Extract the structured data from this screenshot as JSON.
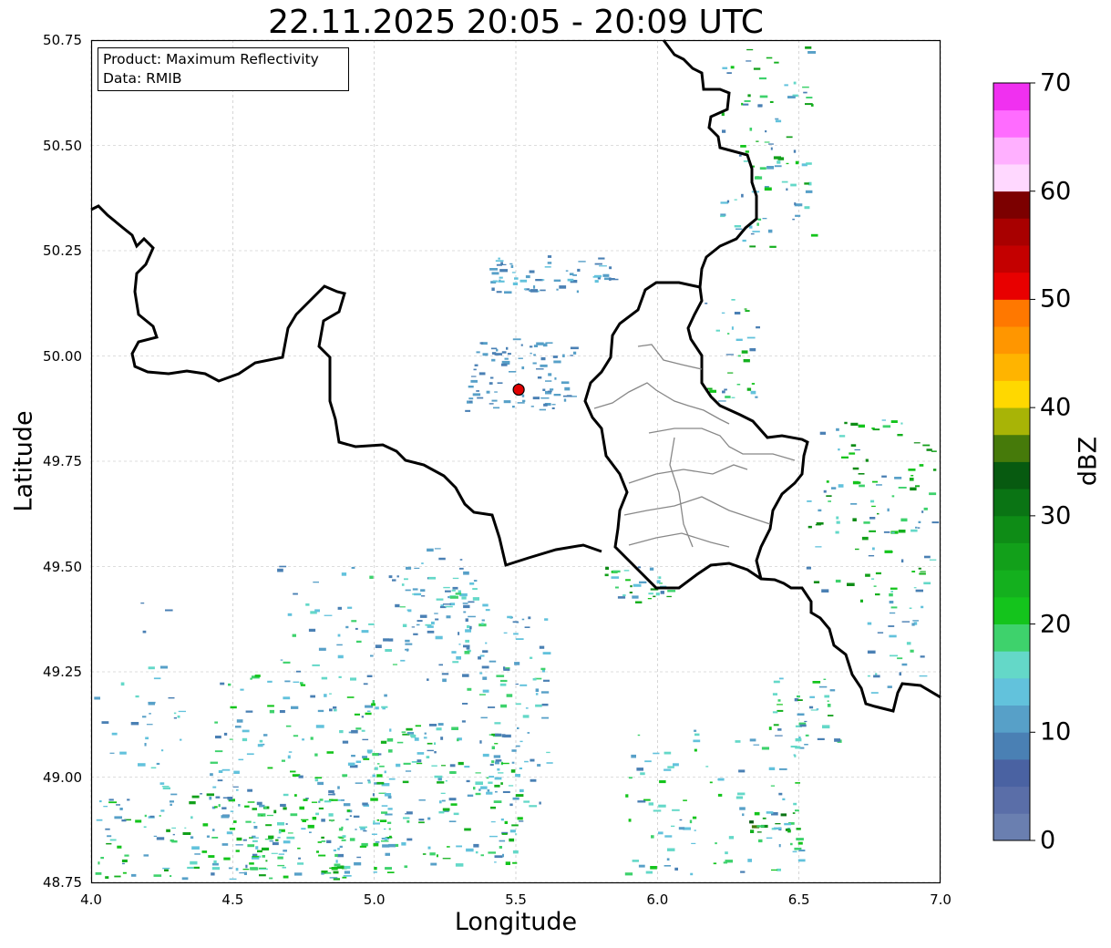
{
  "title": "22.11.2025 20:05 - 20:09 UTC",
  "xlabel": "Longitude",
  "ylabel": "Latitude",
  "colorbar_label": "dBZ",
  "info": {
    "product": "Product: Maximum Reflectivity",
    "data": "Data: RMIB"
  },
  "x_ticks": [
    "4.0",
    "4.5",
    "5.0",
    "5.5",
    "6.0",
    "6.5",
    "7.0"
  ],
  "y_ticks": [
    "48.75",
    "49.00",
    "49.25",
    "49.50",
    "49.75",
    "50.00",
    "50.25",
    "50.50",
    "50.75"
  ],
  "colorbar_ticks": [
    "0",
    "10",
    "20",
    "30",
    "40",
    "50",
    "60",
    "70"
  ],
  "colors": {
    "border": "#000000",
    "admin_border": "#888888",
    "radar_marker": "#e00000",
    "colorbar": [
      "#6a7fb0",
      "#5a6ea8",
      "#4a62a2",
      "#4a80b4",
      "#57a0c8",
      "#62c2dc",
      "#64d8c8",
      "#3ed26c",
      "#14c41c",
      "#14b01e",
      "#12a01a",
      "#0e8c16",
      "#0a7414",
      "#075a10",
      "#467a0a",
      "#a8b406",
      "#ffd800",
      "#ffb400",
      "#ff9600",
      "#ff7800",
      "#e80000",
      "#c40000",
      "#a80000",
      "#7c0000",
      "#ffd8ff",
      "#ffb0ff",
      "#ff6cff",
      "#f030f0"
    ]
  },
  "map": {
    "lon_range": [
      4.0,
      7.0
    ],
    "lat_range": [
      48.75,
      50.75
    ],
    "radar_site": {
      "lon": 5.51,
      "lat": 49.92
    }
  }
}
